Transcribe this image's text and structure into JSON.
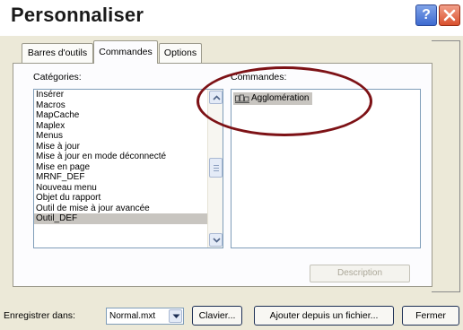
{
  "window": {
    "title": "Personnaliser"
  },
  "tabs": [
    {
      "label": "Barres d'outils"
    },
    {
      "label": "Commandes"
    },
    {
      "label": "Options"
    }
  ],
  "categories": {
    "label": "Catégories:",
    "items": [
      "Insérer",
      "Macros",
      "MapCache",
      "Maplex",
      "Menus",
      "Mise à jour",
      "Mise à jour en mode déconnecté",
      "Mise en page",
      "MRNF_DEF",
      "Nouveau menu",
      "Objet du rapport",
      "Outil de mise à jour avancée",
      "Outil_DEF"
    ],
    "selected": "Outil_DEF"
  },
  "commands": {
    "label": "Commandes:",
    "items": [
      {
        "label": "Agglomération",
        "icon": "agglomeration-icon"
      }
    ]
  },
  "description_button": "Description",
  "save_label": "Enregistrer dans:",
  "save_value": "Normal.mxt",
  "buttons": {
    "clavier": "Clavier...",
    "ajouter": "Ajouter depuis un fichier...",
    "fermer": "Fermer"
  },
  "colors": {
    "highlight_oval": "#7d1216",
    "selection": "#c8c5c0",
    "dialog_bg": "#ece9d8"
  }
}
